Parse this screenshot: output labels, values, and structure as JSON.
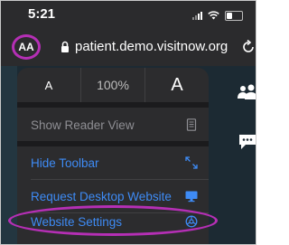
{
  "status_bar": {
    "time": "5:21",
    "signal_icon": "cellular-signal-icon",
    "wifi_icon": "wifi-icon",
    "battery_icon": "battery-icon"
  },
  "address_bar": {
    "aa_label": "AA",
    "url": "patient.demo.visitnow.org",
    "lock_icon": "lock-icon",
    "reload_icon": "reload-icon"
  },
  "menu": {
    "font_smaller": "A",
    "zoom_level": "100%",
    "font_larger": "A",
    "items": [
      {
        "label": "Show Reader View",
        "icon": "reader-view-icon",
        "enabled": false
      },
      {
        "label": "Hide Toolbar",
        "icon": "expand-arrows-icon",
        "enabled": true
      },
      {
        "label": "Request Desktop Website",
        "icon": "desktop-monitor-icon",
        "enabled": true
      },
      {
        "label": "Website Settings",
        "icon": "settings-gear-icon",
        "enabled": true
      }
    ]
  },
  "colors": {
    "highlight": "#b52fb5",
    "link_blue": "#3e8bf5",
    "disabled_gray": "#8e8e93"
  }
}
